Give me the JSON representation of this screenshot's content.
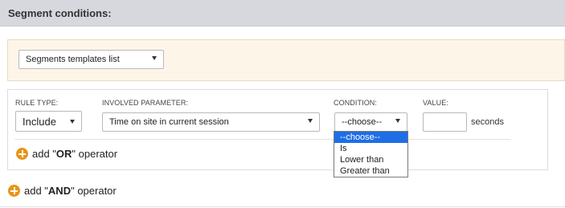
{
  "header": {
    "title": "Segment conditions:"
  },
  "templates": {
    "select_label": "Segments templates list"
  },
  "rule": {
    "columns": {
      "rule_type": "RULE TYPE:",
      "involved_parameter": "INVOLVED PARAMETER:",
      "condition": "CONDITION:",
      "value": "VALUE:"
    },
    "rule_type_value": "Include",
    "parameter_value": "Time on site in current session",
    "condition_value": "--choose--",
    "value_input": "",
    "value_unit": "seconds",
    "condition_options": [
      {
        "label": "--choose--",
        "selected": true
      },
      {
        "label": "Is",
        "selected": false
      },
      {
        "label": "Lower than",
        "selected": false
      },
      {
        "label": "Greater than",
        "selected": false
      }
    ]
  },
  "actions": {
    "add_or": {
      "prefix": "add \"",
      "keyword": "OR",
      "suffix": "\" operator"
    },
    "add_and": {
      "prefix": "add \"",
      "keyword": "AND",
      "suffix": "\" operator"
    }
  },
  "colors": {
    "header_bg": "#d7d8de",
    "templates_bg": "#fdf6e8",
    "accent_plus": "#e8941a",
    "dropdown_highlight": "#1e6ee6"
  }
}
